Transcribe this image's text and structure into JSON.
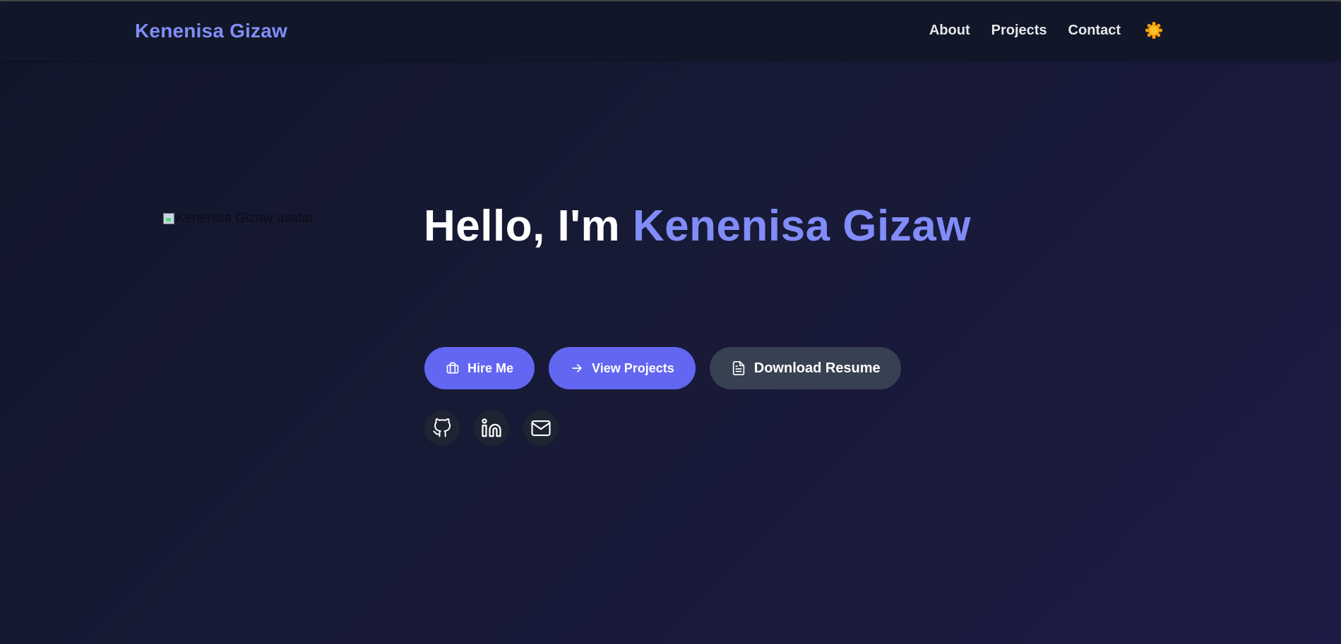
{
  "nav": {
    "brand": "Kenenisa Gizaw",
    "links": [
      "About",
      "Projects",
      "Contact"
    ],
    "theme_icon": "sun-icon"
  },
  "hero": {
    "avatar_alt": "Kenenisa Gizaw avatar",
    "greeting": "Hello, I'm",
    "name": "Kenenisa Gizaw",
    "buttons": {
      "hire": {
        "label": "Hire Me",
        "icon": "briefcase-icon"
      },
      "projects": {
        "label": "View Projects",
        "icon": "arrow-right-icon"
      },
      "resume": {
        "label": "Download Resume",
        "icon": "document-icon"
      }
    },
    "socials": [
      "github-icon",
      "linkedin-icon",
      "mail-icon"
    ]
  },
  "colors": {
    "accent": "#818cf8",
    "primary_button": "#6366f1",
    "secondary_button": "#374151",
    "navbar_bg": "#111728",
    "sun": "#f59e0b"
  }
}
